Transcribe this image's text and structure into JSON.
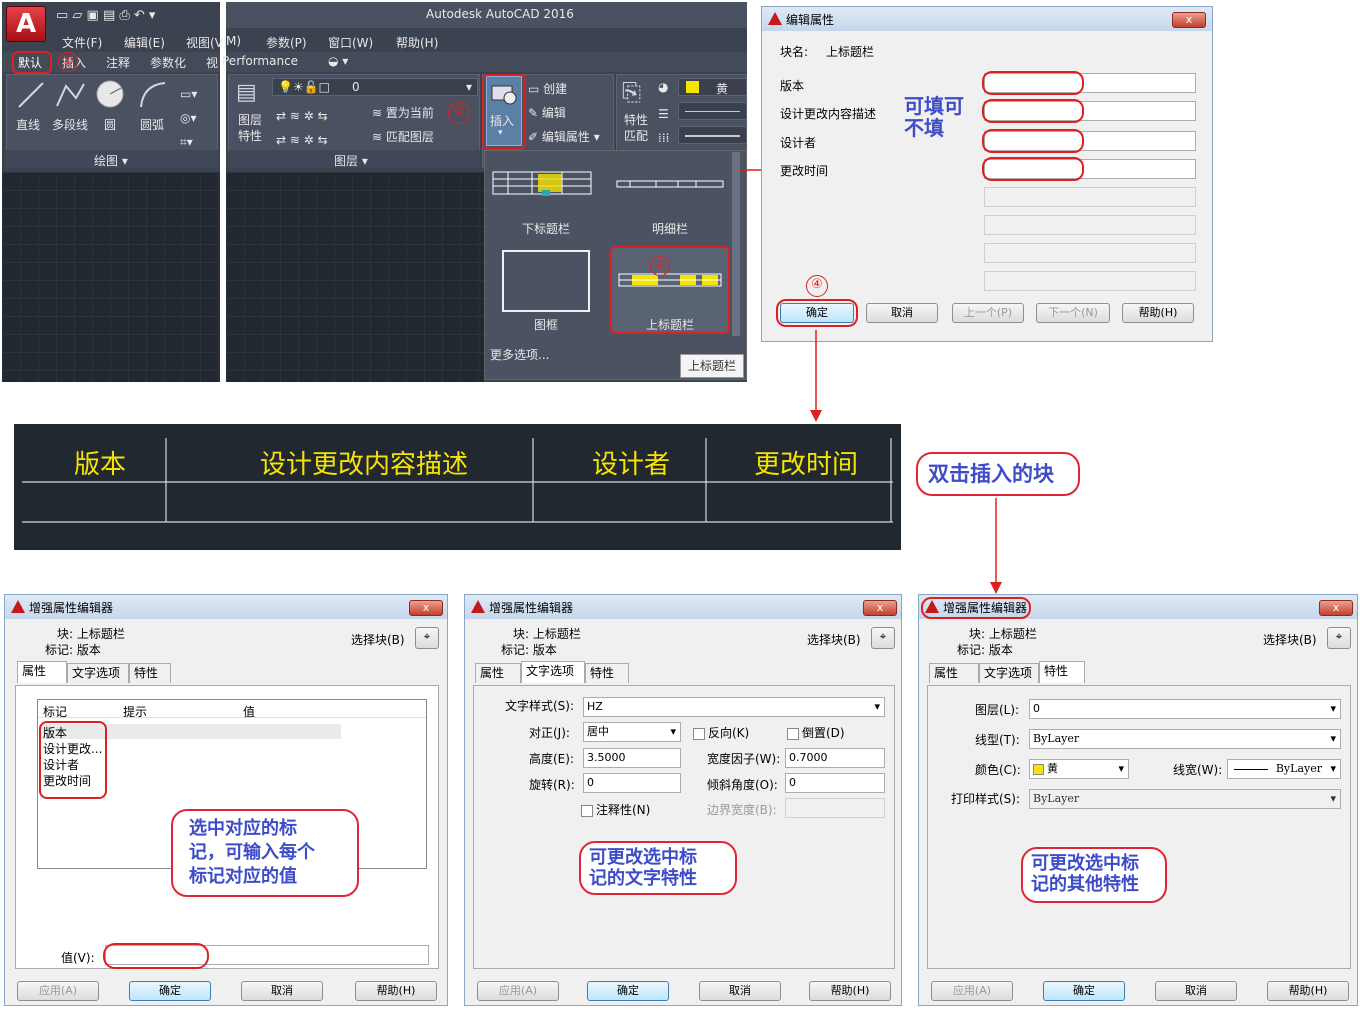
{
  "autocad": {
    "app_title": "Autodesk AutoCAD 2016",
    "menu": [
      "文件(F)",
      "编辑(E)",
      "视图(V)",
      "M)",
      "参数(P)",
      "窗口(W)",
      "帮助(H)"
    ],
    "tabs": [
      "默认",
      "插入",
      "注释",
      "参数化",
      "视",
      "Performance"
    ],
    "draw_tools": [
      "直线",
      "多段线",
      "圆",
      "圆弧"
    ],
    "draw_panel": "绘图",
    "layer_props": "图层\n特性",
    "layer_name": "0",
    "layer_set_current": "置为当前",
    "layer_match": "匹配图层",
    "layer_panel": "图层",
    "insert_label": "插入",
    "block_create": "创建",
    "block_edit": "编辑",
    "block_edit_attr": "编辑属性",
    "props_match": "特性\n匹配",
    "color_value": "黄",
    "gallery": [
      "下标题栏",
      "明细栏",
      "图框",
      "上标题栏"
    ],
    "more_options": "更多选项...",
    "tooltip": "上标题栏",
    "step1": "①",
    "step2": "②",
    "step3": "③",
    "step4": "④"
  },
  "edit_attr_dialog": {
    "title": "编辑属性",
    "close": "x",
    "block_name_label": "块名:",
    "block_name": "上标题栏",
    "fields": [
      "版本",
      "设计更改内容描述",
      "设计者",
      "更改时间"
    ],
    "annotation": "可填可\n不填",
    "buttons": [
      "确定",
      "取消",
      "上一个(P)",
      "下一个(N)",
      "帮助(H)"
    ]
  },
  "title_block": {
    "headers": [
      "版本",
      "设计更改内容描述",
      "设计者",
      "更改时间"
    ]
  },
  "dblclick_note": "双击插入的块",
  "enhanced_dialogs": [
    {
      "title": "增强属性编辑器",
      "block_line": "块: 上标题栏",
      "tag_line": "标记: 版本",
      "select_block": "选择块(B)",
      "tabs": [
        "属性",
        "文字选项",
        "特性"
      ],
      "active_tab": 0,
      "columns": [
        "标记",
        "提示",
        "值"
      ],
      "rows": [
        "版本",
        "设计更改...",
        "设计者",
        "更改时间"
      ],
      "value_label": "值(V):",
      "callout": "选中对应的标\n记，可输入每个\n标记对应的值",
      "buttons": [
        "应用(A)",
        "确定",
        "取消",
        "帮助(H)"
      ]
    },
    {
      "title": "增强属性编辑器",
      "block_line": "块: 上标题栏",
      "tag_line": "标记: 版本",
      "select_block": "选择块(B)",
      "tabs": [
        "属性",
        "文字选项",
        "特性"
      ],
      "active_tab": 1,
      "text_style_label": "文字样式(S):",
      "text_style": "HZ",
      "justify_label": "对正(J):",
      "justify": "居中",
      "reverse_label": "反向(K)",
      "upside_label": "倒置(D)",
      "height_label": "高度(E):",
      "height": "3.5000",
      "width_label": "宽度因子(W):",
      "width": "0.7000",
      "rotation_label": "旋转(R):",
      "rotation": "0",
      "oblique_label": "倾斜角度(O):",
      "oblique": "0",
      "annotative_label": "注释性(N)",
      "boundary_label": "边界宽度(B):",
      "callout": "可更改选中标\n记的文字特性",
      "buttons": [
        "应用(A)",
        "确定",
        "取消",
        "帮助(H)"
      ]
    },
    {
      "title": "增强属性编辑器",
      "block_line": "块: 上标题栏",
      "tag_line": "标记: 版本",
      "select_block": "选择块(B)",
      "tabs": [
        "属性",
        "文字选项",
        "特性"
      ],
      "active_tab": 2,
      "layer_label": "图层(L):",
      "layer": "0",
      "linetype_label": "线型(T):",
      "linetype": "ByLayer",
      "color_label": "颜色(C):",
      "color": "黄",
      "lineweight_label": "线宽(W):",
      "lineweight": "ByLayer",
      "plotstyle_label": "打印样式(S):",
      "plotstyle": "ByLayer",
      "callout": "可更改选中标\n记的其他特性",
      "buttons": [
        "应用(A)",
        "确定",
        "取消",
        "帮助(H)"
      ]
    }
  ],
  "colors": {
    "accent_red": "#e02020",
    "callout_blue": "#3e4cc8",
    "yellow": "#f5e400"
  }
}
